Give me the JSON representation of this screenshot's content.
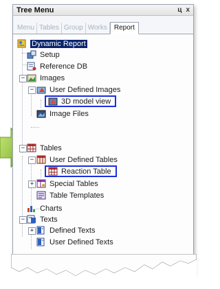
{
  "window": {
    "title": "Tree Menu",
    "pin_label": "ц",
    "close_label": "x"
  },
  "tabs": [
    {
      "label": "Menu",
      "active": false
    },
    {
      "label": "Tables",
      "active": false
    },
    {
      "label": "Group",
      "active": false
    },
    {
      "label": "Works",
      "active": false
    },
    {
      "label": "Report",
      "active": true
    }
  ],
  "tree": {
    "root": {
      "label": "Dynamic Report",
      "icon": "report-icon"
    },
    "setup": {
      "label": "Setup",
      "icon": "setup-icon"
    },
    "reference_db": {
      "label": "Reference DB",
      "icon": "database-icon"
    },
    "images": {
      "label": "Images",
      "icon": "images-icon",
      "expander": "−"
    },
    "user_defined_images": {
      "label": "User Defined Images",
      "icon": "image-folder-icon",
      "expander": "−"
    },
    "model_view": {
      "label": "3D model view",
      "icon": "3d-model-icon"
    },
    "image_files": {
      "label": "Image Files",
      "icon": "image-files-icon"
    },
    "tables": {
      "label": "Tables",
      "icon": "table-icon",
      "expander": "−"
    },
    "user_defined_tables": {
      "label": "User Defined Tables",
      "icon": "table-folder-icon",
      "expander": "−"
    },
    "reaction_table": {
      "label": "Reaction Table",
      "icon": "table-icon"
    },
    "special_tables": {
      "label": "Special Tables",
      "icon": "special-table-icon",
      "expander": "+"
    },
    "table_templates": {
      "label": "Table Templates",
      "icon": "template-icon"
    },
    "charts": {
      "label": "Charts",
      "icon": "chart-icon"
    },
    "texts": {
      "label": "Texts",
      "icon": "text-icon",
      "expander": "−"
    },
    "defined_texts": {
      "label": "Defined Texts",
      "icon": "text-doc-icon",
      "expander": "+"
    },
    "user_defined_texts": {
      "label": "User Defined Texts",
      "icon": "text-doc-icon"
    }
  },
  "colors": {
    "highlight_box": "#1b2fdc",
    "selection": "#0a246a",
    "arrow": "#9ccc3c"
  }
}
